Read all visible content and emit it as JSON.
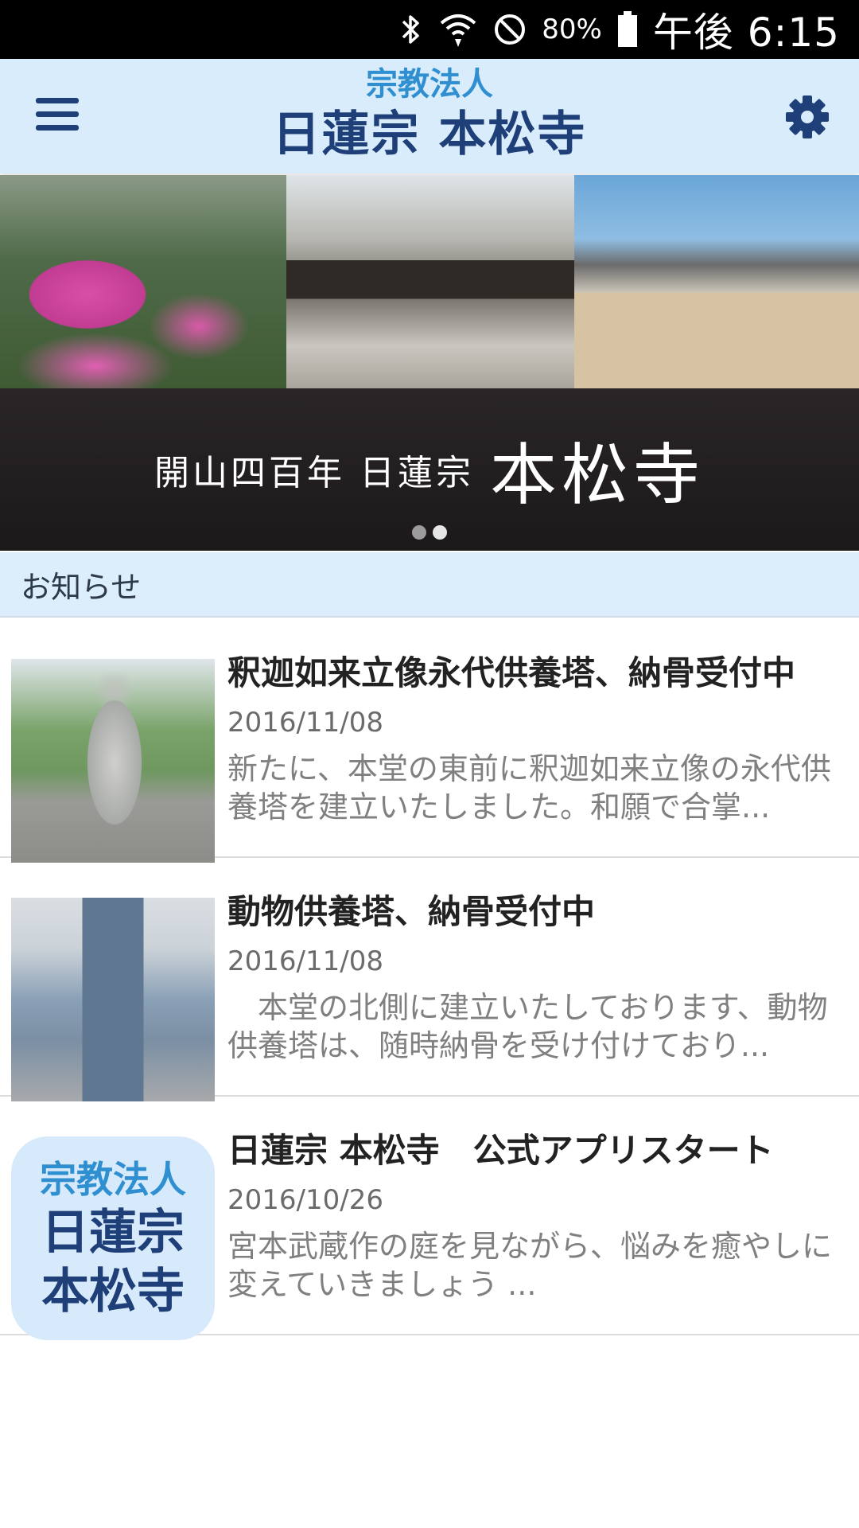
{
  "status_bar": {
    "battery_percent": "80%",
    "clock": "午後 6:15",
    "icons": [
      "bluetooth-icon",
      "wifi-icon",
      "do-not-disturb-icon",
      "battery-icon"
    ]
  },
  "header": {
    "brand_sub": "宗教法人",
    "brand_main": "日蓮宗 本松寺",
    "menu_icon": "hamburger-menu-icon",
    "settings_icon": "gear-icon",
    "accent_color": "#1f3f79",
    "background_color": "#d9ecfb"
  },
  "hero": {
    "caption_small": "開山四百年 日蓮宗",
    "caption_big": "本松寺",
    "slides": 2,
    "active_slide": 2
  },
  "section": {
    "title": "お知らせ"
  },
  "news": [
    {
      "title": "釈迦如来立像永代供養塔、納骨受付中",
      "date": "2016/11/08",
      "excerpt": "新たに、本堂の東前に釈迦如来立像の永代供養塔を建立いたしました。和願で合掌..."
    },
    {
      "title": "動物供養塔、納骨受付中",
      "date": "2016/11/08",
      "excerpt": "　本堂の北側に建立いたしております、動物供養塔は、随時納骨を受け付けており..."
    },
    {
      "title": "日蓮宗 本松寺　公式アプリスタート",
      "date": "2016/10/26",
      "excerpt": "宮本武蔵作の庭を見ながら、悩みを癒やしに変えていきましょう ...",
      "logo": {
        "sub": "宗教法人",
        "line1": "日蓮宗",
        "line2": "本松寺"
      }
    }
  ]
}
